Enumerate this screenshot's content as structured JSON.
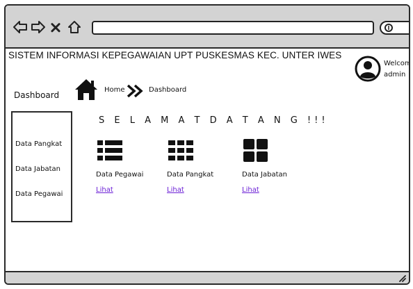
{
  "header": {
    "app_title": "SISTEM INFORMASI KEPEGAWAIAN UPT PUSKESMAS KEC. UNTER IWES",
    "welcome": "Welcome",
    "user_name": "admin"
  },
  "page": {
    "heading": "Dashboard"
  },
  "breadcrumb": {
    "home": "Home",
    "current": "Dashboard"
  },
  "sidebar": {
    "items": [
      {
        "label": "Data Pangkat"
      },
      {
        "label": "Data Jabatan"
      },
      {
        "label": "Data Pegawai"
      }
    ]
  },
  "main": {
    "welcome_text": "S E L A M A T D A T A N G !!!",
    "cards": [
      {
        "label": "Data Pegawai",
        "link": "Lihat",
        "icon": "list-icon"
      },
      {
        "label": "Data Pangkat",
        "link": "Lihat",
        "icon": "grid-nine-icon"
      },
      {
        "label": "Data Jabatan",
        "link": "Lihat",
        "icon": "grid-four-icon"
      }
    ]
  },
  "browser": {
    "icons": [
      "back-arrow-icon",
      "forward-arrow-icon",
      "close-icon",
      "home-outline-icon",
      "search-icon"
    ]
  },
  "colors": {
    "chrome": "#d3d3d3",
    "link": "#6b1fd6",
    "outline": "#2a2a2a"
  }
}
